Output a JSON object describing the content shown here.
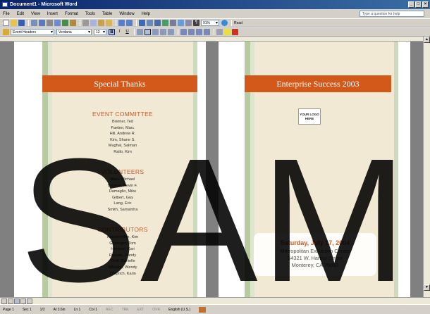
{
  "window": {
    "title": "Document1 - Microsoft Word"
  },
  "menu": {
    "items": [
      "File",
      "Edit",
      "View",
      "Insert",
      "Format",
      "Tools",
      "Table",
      "Window",
      "Help"
    ],
    "help_placeholder": "Type a question for help"
  },
  "toolbar": {
    "zoom": "91%",
    "read_label": "Read",
    "style": "Event Headers",
    "font": "Verdana",
    "size": "12"
  },
  "page_left": {
    "banner": "Special Thanks",
    "sections": [
      {
        "heading": "EVENT COMMITTEE",
        "names": [
          "Bremer, Ted",
          "Faeber, Marc",
          "Hill, Andrew R.",
          "Kim, Shane S.",
          "Mughal, Salman",
          "Rallo, Kim"
        ]
      },
      {
        "heading": "VOLUNTEERS",
        "names": [
          "Allen, Michael",
          "Browne, Kevin F.",
          "Damaglio, Mike",
          "Gilbert, Guy",
          "Lang, Eric",
          "Smith, Samantha"
        ]
      },
      {
        "heading": "CONTRIBUTORS",
        "names": [
          "Abercrombie, Kim",
          "Getzinger, Tom",
          "Hensien, Kari",
          "Reeves, Randy",
          "Tiedt, Danielle",
          "Wheeler, Wendy",
          "Zimprich, Karin"
        ]
      }
    ]
  },
  "page_right": {
    "banner": "Enterprise Success 2003",
    "logo_text": "YOUR LOGO HERE",
    "event": {
      "date": "Saturday, July 17, 2004",
      "venue": "Metropolitan Exhibition Center",
      "street": "54321 W. Harbor Street",
      "city": "Monterey, CA  75050"
    }
  },
  "status": {
    "page": "Page 1",
    "sec": "Sec 1",
    "pages": "1/2",
    "at": "At 3.6in",
    "ln": "Ln 1",
    "col": "Col 1",
    "rec": "REC",
    "trk": "TRK",
    "ext": "EXT",
    "ovr": "OVR",
    "lang": "English (U.S.)"
  },
  "watermark_text": "SAM",
  "colors": {
    "accent": "#d2591a",
    "heading": "#c55a2a",
    "stripe_cream": "#f1e9d4",
    "stripe_green": "#b9c9a0",
    "titlebar": "#0a246a"
  }
}
